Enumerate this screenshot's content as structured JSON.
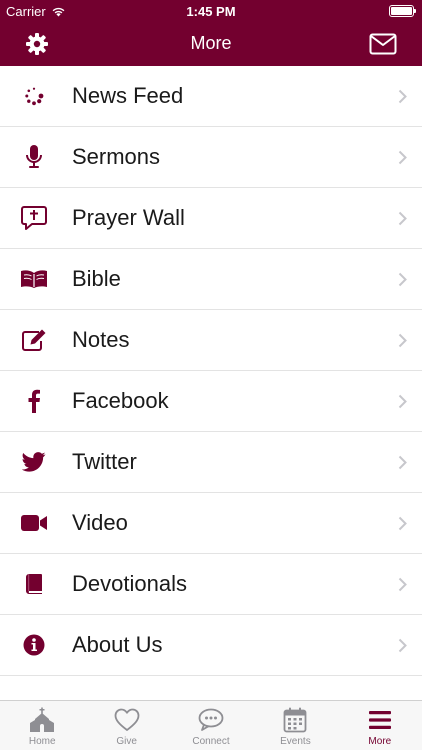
{
  "status_bar": {
    "carrier": "Carrier",
    "time": "1:45 PM"
  },
  "nav_bar": {
    "title": "More",
    "left_icon": "gear-icon",
    "right_icon": "mail-icon"
  },
  "menu": {
    "items": [
      {
        "label": "News Feed",
        "icon": "news-feed-icon"
      },
      {
        "label": "Sermons",
        "icon": "microphone-icon"
      },
      {
        "label": "Prayer Wall",
        "icon": "prayer-wall-icon"
      },
      {
        "label": "Bible",
        "icon": "bible-icon"
      },
      {
        "label": "Notes",
        "icon": "notes-icon"
      },
      {
        "label": "Facebook",
        "icon": "facebook-icon"
      },
      {
        "label": "Twitter",
        "icon": "twitter-icon"
      },
      {
        "label": "Video",
        "icon": "video-camera-icon"
      },
      {
        "label": "Devotionals",
        "icon": "book-icon"
      },
      {
        "label": "About Us",
        "icon": "info-icon"
      }
    ]
  },
  "tab_bar": {
    "tabs": [
      {
        "label": "Home",
        "icon": "church-icon",
        "active": false
      },
      {
        "label": "Give",
        "icon": "heart-icon",
        "active": false
      },
      {
        "label": "Connect",
        "icon": "chat-icon",
        "active": false
      },
      {
        "label": "Events",
        "icon": "calendar-icon",
        "active": false
      },
      {
        "label": "More",
        "icon": "menu-icon",
        "active": true
      }
    ]
  },
  "colors": {
    "brand": "#73002f",
    "inactive_tab": "#8e8e93",
    "divider": "#e3e3e3"
  }
}
